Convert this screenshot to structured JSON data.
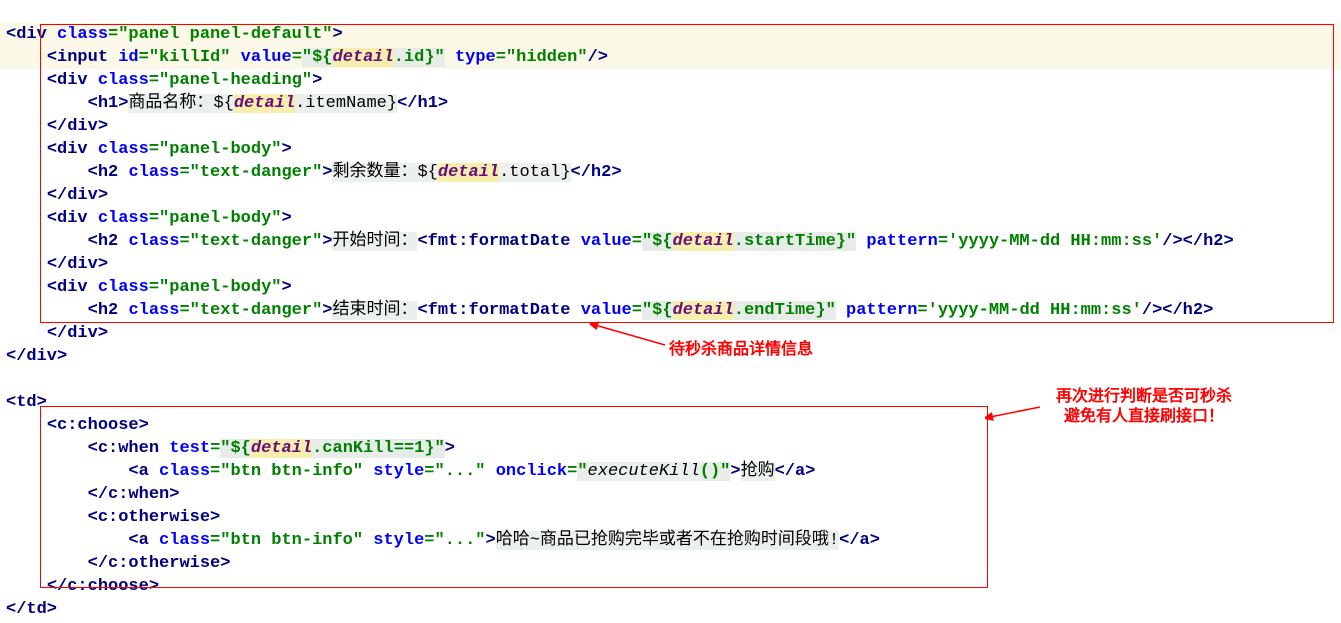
{
  "lines": {
    "l1": {
      "open": "<div ",
      "attr1": "class",
      "eq": "=",
      "val1": "\"panel panel-default\"",
      "close": ">"
    },
    "l2": {
      "open": "<input ",
      "a1": "id",
      "v1": "\"killId\"",
      "a2": "value",
      "v2a": "\"",
      "v2b": "${",
      "v2c": "detail",
      "v2d": ".id}",
      "v2e": "\"",
      "a3": "type",
      "v3": "\"hidden\"",
      "close": "/>"
    },
    "l3": {
      "open": "<div ",
      "a1": "class",
      "v1": "\"panel-heading\"",
      "close": ">"
    },
    "l4": {
      "open": "<h1>",
      "text1": "商品名称：",
      "text2": "${",
      "d": "detail",
      "text3": ".itemName}",
      "close": "</h1>"
    },
    "l5": {
      "close": "</div>"
    },
    "l6": {
      "open": "<div ",
      "a1": "class",
      "v1": "\"panel-body\"",
      "close": ">"
    },
    "l7": {
      "open": "<h2 ",
      "a1": "class",
      "v1": "\"text-danger\"",
      "gt": ">",
      "text1": "剩余数量：",
      "text2": "${",
      "d": "detail",
      "text3": ".total}",
      "close": "</h2>"
    },
    "l8": {
      "close": "</div>"
    },
    "l9": {
      "open": "<div ",
      "a1": "class",
      "v1": "\"panel-body\"",
      "close": ">"
    },
    "l10": {
      "open": "<h2 ",
      "a1": "class",
      "v1": "\"text-danger\"",
      "gt": ">",
      "text1": "开始时间：",
      "tag2": "<fmt:formatDate ",
      "a2": "value",
      "v2a": "\"",
      "v2b": "${",
      "d": "detail",
      "v2c": ".startTime}",
      "v2d": "\"",
      "a3": "pattern",
      "v3": "'yyyy-MM-dd HH:mm:ss'",
      "ct": "/>",
      "close": "</h2>"
    },
    "l11": {
      "close": "</div>"
    },
    "l12": {
      "open": "<div ",
      "a1": "class",
      "v1": "\"panel-body\"",
      "close": ">"
    },
    "l13": {
      "open": "<h2 ",
      "a1": "class",
      "v1": "\"text-danger\"",
      "gt": ">",
      "text1": "结束时间：",
      "tag2": "<fmt:formatDate ",
      "a2": "value",
      "v2a": "\"",
      "v2b": "${",
      "d": "detail",
      "v2c": ".endTime}",
      "v2d": "\"",
      "a3": "pattern",
      "v3": "'yyyy-MM-dd HH:mm:ss'",
      "ct": "/>",
      "close": "</h2>"
    },
    "l14": {
      "close": "</div>"
    },
    "l15": {
      "close": "</div>"
    },
    "l17": {
      "open": "<td>"
    },
    "l18": {
      "open": "<c:choose>"
    },
    "l19": {
      "open": "<c:when ",
      "a1": "test",
      "v1a": "\"",
      "v1b": "${",
      "d": "detail",
      "v1c": ".canKill==1}",
      "v1d": "\"",
      "close": ">"
    },
    "l20": {
      "open": "<a ",
      "a1": "class",
      "v1": "\"btn btn-info\"",
      "a2": "style",
      "v2": "\"...\"",
      "a3": "onclick",
      "v3a": "\"",
      "fn": "executeKill",
      "v3b": "()",
      "v3c": "\"",
      "gt": ">",
      "text": "抢购",
      "close": "</a>"
    },
    "l21": {
      "close": "</c:when>"
    },
    "l22": {
      "open": "<c:otherwise>"
    },
    "l23": {
      "open": "<a ",
      "a1": "class",
      "v1": "\"btn btn-info\"",
      "a2": "style",
      "v2": "\"...\"",
      "gt": ">",
      "text": "哈哈~商品已抢购完毕或者不在抢购时间段哦!",
      "close": "</a>"
    },
    "l24": {
      "close": "</c:otherwise>"
    },
    "l25": {
      "close": "</c:choose>"
    },
    "l26": {
      "close": "</td>"
    }
  },
  "annotations": {
    "a1": "待秒杀商品详情信息",
    "a2_l1": "再次进行判断是否可秒杀",
    "a2_l2": "避免有人直接刷接口！"
  }
}
